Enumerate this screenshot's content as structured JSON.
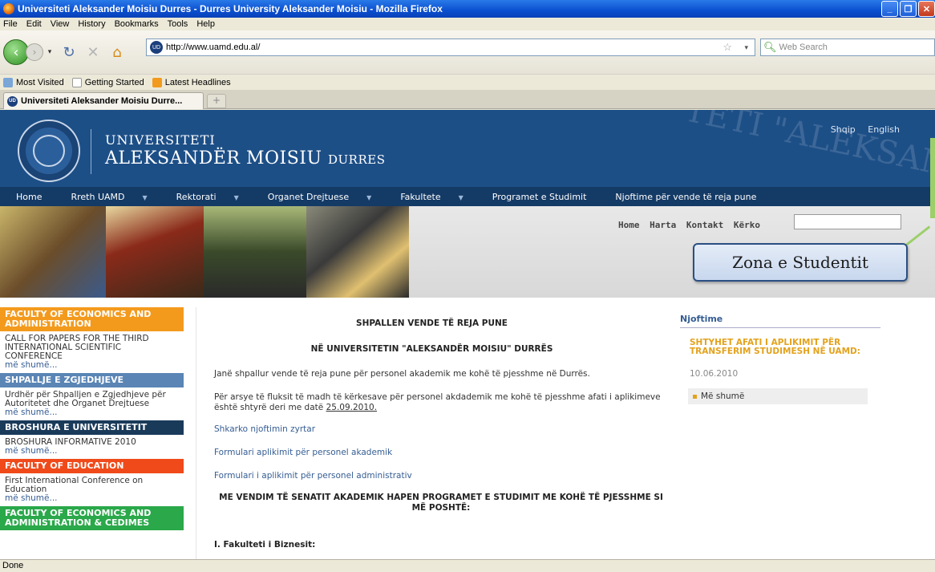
{
  "window": {
    "title": "Universiteti Aleksander Moisiu Durres - Durres University Aleksander Moisiu - Mozilla Firefox"
  },
  "menu": [
    "File",
    "Edit",
    "View",
    "History",
    "Bookmarks",
    "Tools",
    "Help"
  ],
  "toolbar": {
    "url": "http://www.uamd.edu.al/",
    "search_placeholder": "Web Search"
  },
  "bookmarks": [
    "Most Visited",
    "Getting Started",
    "Latest Headlines"
  ],
  "tab": {
    "title": "Universiteti Aleksander Moisiu Durre..."
  },
  "site": {
    "title_line1": "Universiteti",
    "title_line2": "Aleksandër Moisiu",
    "title_line2_city": "Durres",
    "watermark": "TETI \"ALEKSANDËR",
    "langs": [
      "Shqip",
      "English"
    ],
    "nav": [
      {
        "label": "Home",
        "arrow": false
      },
      {
        "label": "Rreth UAMD",
        "arrow": true
      },
      {
        "label": "Rektorati",
        "arrow": true
      },
      {
        "label": "Organet Drejtuese",
        "arrow": true
      },
      {
        "label": "Fakultete",
        "arrow": true
      },
      {
        "label": "Programet e Studimit",
        "arrow": false
      },
      {
        "label": "Njoftime për vende të reja pune",
        "arrow": false
      }
    ],
    "toplinks": [
      "Home",
      "Harta",
      "Kontakt",
      "Kërko"
    ],
    "callout": "Zona e Studentit"
  },
  "left": [
    {
      "head": "FACULTY OF ECONOMICS AND ADMINISTRATION",
      "color": "#f39a1d",
      "body": "CALL FOR PAPERS FOR THE THIRD INTERNATIONAL SCIENTIFIC CONFERENCE",
      "more": "më shumë..."
    },
    {
      "head": "SHPALLJE E ZGJEDHJEVE",
      "color": "#5a85b5",
      "body": "Urdhër për Shpalljen e Zgjedhjeve për Autoritetet dhe Organet Drejtuese",
      "more": "më shumë..."
    },
    {
      "head": "BROSHURA E UNIVERSITETIT",
      "color": "#1a3a5a",
      "body": "BROSHURA INFORMATIVE 2010",
      "more": "më shumë..."
    },
    {
      "head": "FACULTY OF EDUCATION",
      "color": "#f04a1a",
      "body": "First International Conference on Education",
      "more": "më shumë..."
    },
    {
      "head": "FACULTY OF ECONOMICS AND ADMINISTRATION & CEDIMES",
      "color": "#2aa84a",
      "body": "",
      "more": ""
    }
  ],
  "main": {
    "heading1": "SHPALLEN VENDE TË REJA PUNE",
    "heading2": "NË UNIVERSITETIN \"ALEKSANDËR MOISIU\" DURRËS",
    "p1": "Janë shpallur vende të reja pune për personel akademik me kohë të pjesshme në Durrës.",
    "p2": "Për arsye të fluksit të madh të kërkesave për personel akdademik me kohë të pjesshme afati i aplikimeve është shtyrë deri me datë",
    "p2_date": "25.09.2010.",
    "link1": "Shkarko njoftimin zyrtar",
    "link2": "Formulari aplikimit për personel akademik",
    "link3": "Formulari i aplikimit për personel administrativ",
    "heading3": "ME VENDIM TË SENATIT AKADEMIK HAPEN PROGRAMET E STUDIMIT ME KOHË TË PJESSHME SI MË POSHTË:",
    "heading4": "I. Fakulteti i Biznesit:"
  },
  "right": {
    "title": "Njoftime",
    "news": "SHTYHET AFATI I APLIKIMIT PËR TRANSFERIM STUDIMESH NË UAMD:",
    "date": "10.06.2010",
    "more": "Më shumë"
  },
  "status": "Done"
}
